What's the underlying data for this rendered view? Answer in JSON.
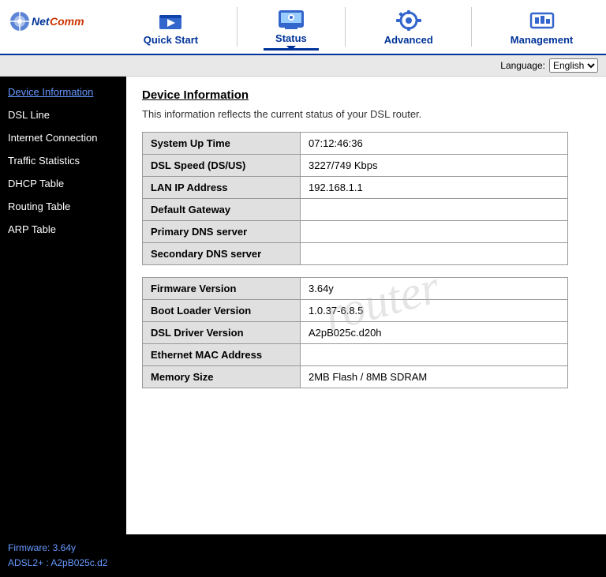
{
  "header": {
    "logo": "NetComm",
    "nav": [
      {
        "id": "quick-start",
        "label": "Quick Start",
        "active": false
      },
      {
        "id": "status",
        "label": "Status",
        "active": true
      },
      {
        "id": "advanced",
        "label": "Advanced",
        "active": false
      },
      {
        "id": "management",
        "label": "Management",
        "active": false
      }
    ]
  },
  "language_bar": {
    "label": "Language:",
    "selected": "English",
    "options": [
      "English"
    ]
  },
  "sidebar": {
    "items": [
      {
        "id": "device-information",
        "label": "Device Information",
        "active": true
      },
      {
        "id": "dsl-line",
        "label": "DSL Line",
        "active": false
      },
      {
        "id": "internet-connection",
        "label": "Internet Connection",
        "active": false
      },
      {
        "id": "traffic-statistics",
        "label": "Traffic Statistics",
        "active": false
      },
      {
        "id": "dhcp-table",
        "label": "DHCP Table",
        "active": false
      },
      {
        "id": "routing-table",
        "label": "Routing Table",
        "active": false
      },
      {
        "id": "arp-table",
        "label": "ARP Table",
        "active": false
      }
    ]
  },
  "content": {
    "title": "Device Information",
    "description": "This information reflects the current status of your DSL router.",
    "table1": [
      {
        "label": "System Up Time",
        "value": "07:12:46:36"
      },
      {
        "label": "DSL Speed (DS/US)",
        "value": "3227/749 Kbps"
      },
      {
        "label": "LAN IP Address",
        "value": "192.168.1.1"
      },
      {
        "label": "Default Gateway",
        "value": ""
      },
      {
        "label": "Primary DNS server",
        "value": ""
      },
      {
        "label": "Secondary DNS server",
        "value": ""
      }
    ],
    "table2": [
      {
        "label": "Firmware Version",
        "value": "3.64y"
      },
      {
        "label": "Boot Loader Version",
        "value": "1.0.37-6.8.5"
      },
      {
        "label": "DSL Driver Version",
        "value": "A2pB025c.d20h"
      },
      {
        "label": "Ethernet MAC Address",
        "value": ""
      },
      {
        "label": "Memory Size",
        "value": "2MB Flash / 8MB SDRAM"
      }
    ],
    "watermark": "router"
  },
  "footer": {
    "line1": "Firmware:  3.64y",
    "line2": "ADSL2+ :  A2pB025c.d2"
  }
}
